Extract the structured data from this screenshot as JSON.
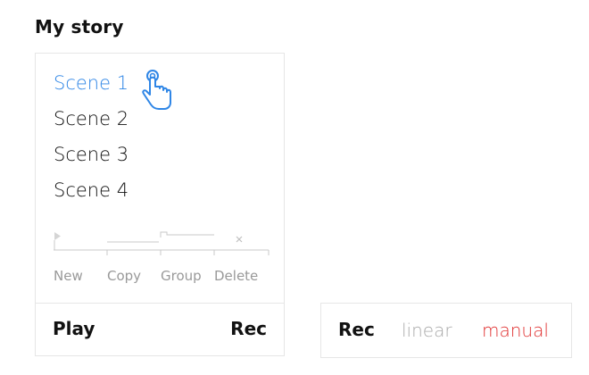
{
  "header": {
    "title": "My story"
  },
  "scenes": [
    {
      "label": "Scene 1",
      "active": true
    },
    {
      "label": "Scene 2",
      "active": false
    },
    {
      "label": "Scene 3",
      "active": false
    },
    {
      "label": "Scene 4",
      "active": false
    }
  ],
  "toolbar": {
    "items": [
      {
        "label": "New",
        "icon": "play-triangle-icon"
      },
      {
        "label": "Copy",
        "icon": "duplicate-line-icon"
      },
      {
        "label": "Group",
        "icon": "group-bracket-icon"
      },
      {
        "label": "Delete",
        "icon": "close-icon"
      }
    ]
  },
  "footer": {
    "play_label": "Play",
    "rec_label": "Rec"
  },
  "recorder": {
    "rec_label": "Rec",
    "modes": [
      {
        "label": "linear",
        "selected": false
      },
      {
        "label": "manual",
        "selected": true
      }
    ]
  },
  "colors": {
    "accent": "#2f86e6",
    "muted": "#aaaaaa",
    "selected_mode": "#e03030",
    "border": "#e6e6e6"
  },
  "cursor": {
    "icon": "hand-pointer-icon"
  }
}
